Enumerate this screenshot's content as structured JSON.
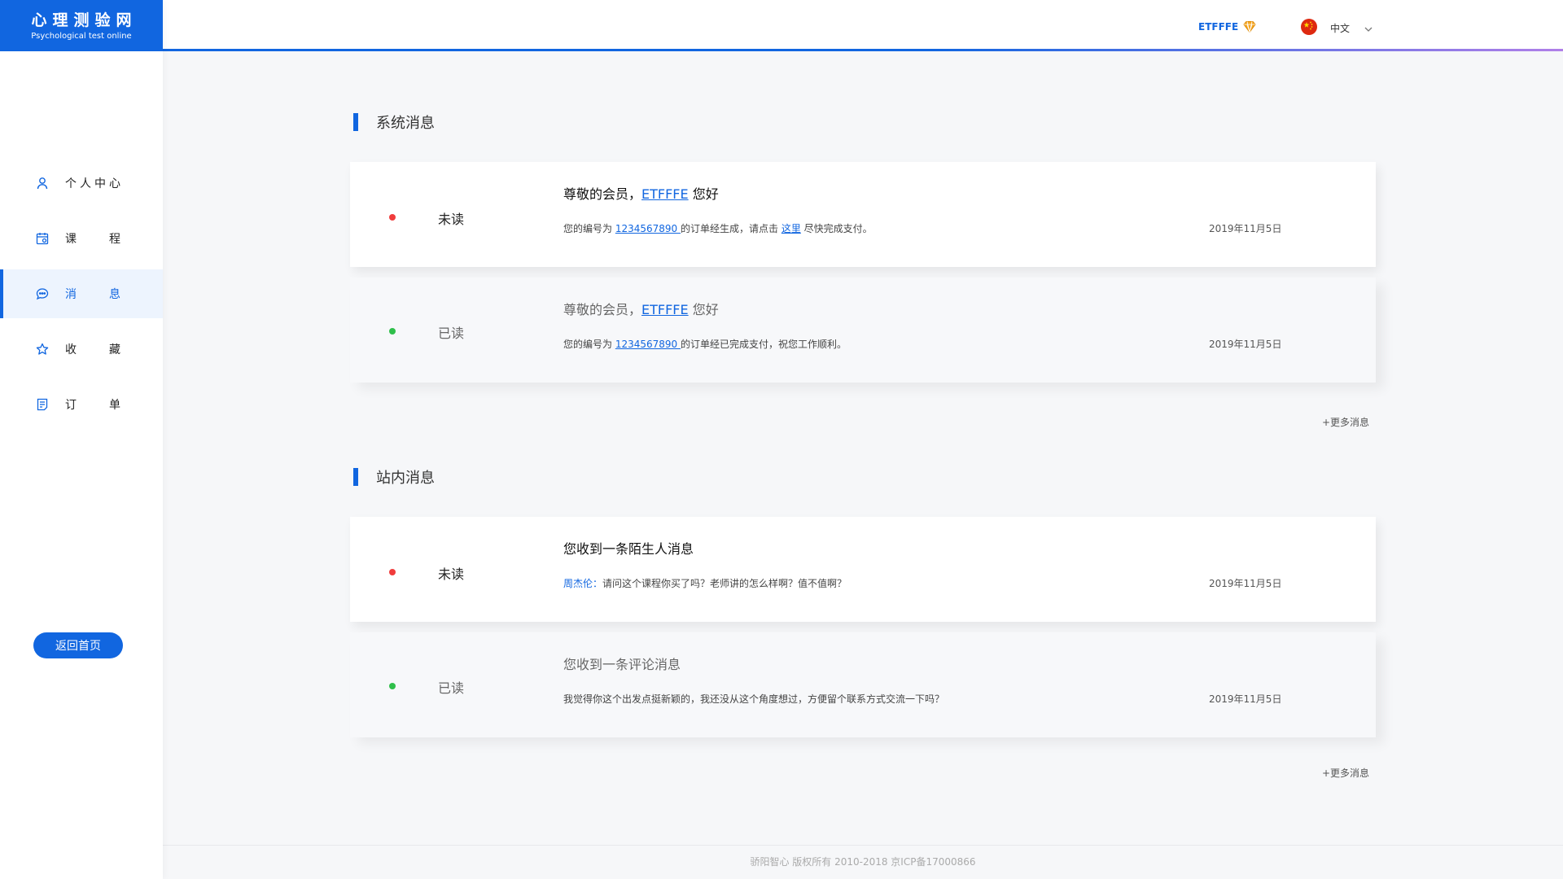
{
  "logo": {
    "title": "心理测验网",
    "subtitle": "Psychological test online"
  },
  "sidebar": {
    "items": [
      {
        "label": "个人中心",
        "icon": "user-icon"
      },
      {
        "label": "课程",
        "icon": "calendar-icon"
      },
      {
        "label": "消息",
        "icon": "chat-icon",
        "active": true
      },
      {
        "label": "收藏",
        "icon": "star-icon"
      },
      {
        "label": "订单",
        "icon": "document-icon"
      }
    ],
    "home_button": "返回首页"
  },
  "header": {
    "username": "ETFFFE",
    "vip_icon": "diamond-icon",
    "language": "中文",
    "flag_icon": "china-flag-icon"
  },
  "colors": {
    "accent": "#1166e0",
    "unread_dot": "#f03c3c",
    "read_dot": "#2fbf4a"
  },
  "system_messages": {
    "title": "系统消息",
    "more": "+更多消息",
    "cards": [
      {
        "status": "未读",
        "title_prefix": "尊敬的会员，",
        "title_link": "ETFFFE",
        "title_suffix": " 您好",
        "body_prefix": "您的编号为 ",
        "body_link": "1234567890 ",
        "body_mid": "的订单经生成，请点击 ",
        "body_link2": "这里",
        "body_suffix": " 尽快完成支付。",
        "date": "2019年11月5日"
      },
      {
        "status": "已读",
        "title_prefix": "尊敬的会员，",
        "title_link": "ETFFFE",
        "title_suffix": " 您好",
        "body_prefix": "您的编号为 ",
        "body_link": "1234567890 ",
        "body_suffix": "的订单经已完成支付，祝您工作顺利。",
        "date": "2019年11月5日"
      }
    ]
  },
  "site_messages": {
    "title": "站内消息",
    "more": "+更多消息",
    "cards": [
      {
        "status": "未读",
        "title": "您收到一条陌生人消息",
        "sender": "周杰伦：",
        "body": "请问这个课程你买了吗？老师讲的怎么样啊？值不值啊？",
        "date": "2019年11月5日"
      },
      {
        "status": "已读",
        "title": "您收到一条评论消息",
        "body": "我觉得你这个出发点挺新颖的，我还没从这个角度想过，方便留个联系方式交流一下吗？",
        "date": "2019年11月5日"
      }
    ]
  },
  "footer": {
    "text": "骄阳智心 版权所有 2010-2018 京ICP备17000866"
  }
}
